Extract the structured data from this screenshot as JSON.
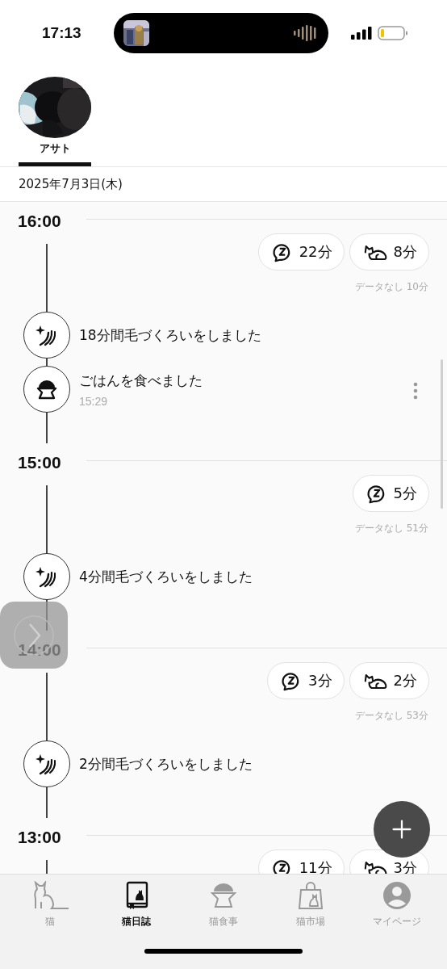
{
  "status_bar": {
    "time": "17:13"
  },
  "cat_tabs": [
    {
      "name": "アサト",
      "selected": true
    }
  ],
  "date": "2025年7月3日(木)",
  "timeline": [
    {
      "hour": "16:00",
      "pills": [
        {
          "kind": "sleep",
          "value": "22分"
        },
        {
          "kind": "active",
          "value": "8分"
        }
      ],
      "no_data": "データなし 10分",
      "events": [
        {
          "kind": "grooming",
          "text": "18分間毛づくろいをしました"
        },
        {
          "kind": "meal",
          "text": "ごはんを食べました",
          "time": "15:29",
          "menu": true
        }
      ]
    },
    {
      "hour": "15:00",
      "pills": [
        {
          "kind": "sleep",
          "value": "5分"
        }
      ],
      "no_data": "データなし 51分",
      "events": [
        {
          "kind": "grooming",
          "text": "4分間毛づくろいをしました"
        }
      ]
    },
    {
      "hour": "14:00",
      "pills": [
        {
          "kind": "sleep",
          "value": "3分"
        },
        {
          "kind": "active",
          "value": "2分"
        }
      ],
      "no_data": "データなし 53分",
      "events": [
        {
          "kind": "grooming",
          "text": "2分間毛づくろいをしました"
        }
      ]
    },
    {
      "hour": "13:00",
      "pills": [
        {
          "kind": "sleep",
          "value": "11分"
        },
        {
          "kind": "active",
          "value": "3分"
        }
      ]
    }
  ],
  "nav": [
    {
      "kind": "cat",
      "label": "猫",
      "selected": false
    },
    {
      "kind": "diary",
      "label": "猫日誌",
      "selected": true
    },
    {
      "kind": "food",
      "label": "猫食事",
      "selected": false
    },
    {
      "kind": "market",
      "label": "猫市場",
      "selected": false
    },
    {
      "kind": "mypage",
      "label": "マイページ",
      "selected": false
    }
  ]
}
